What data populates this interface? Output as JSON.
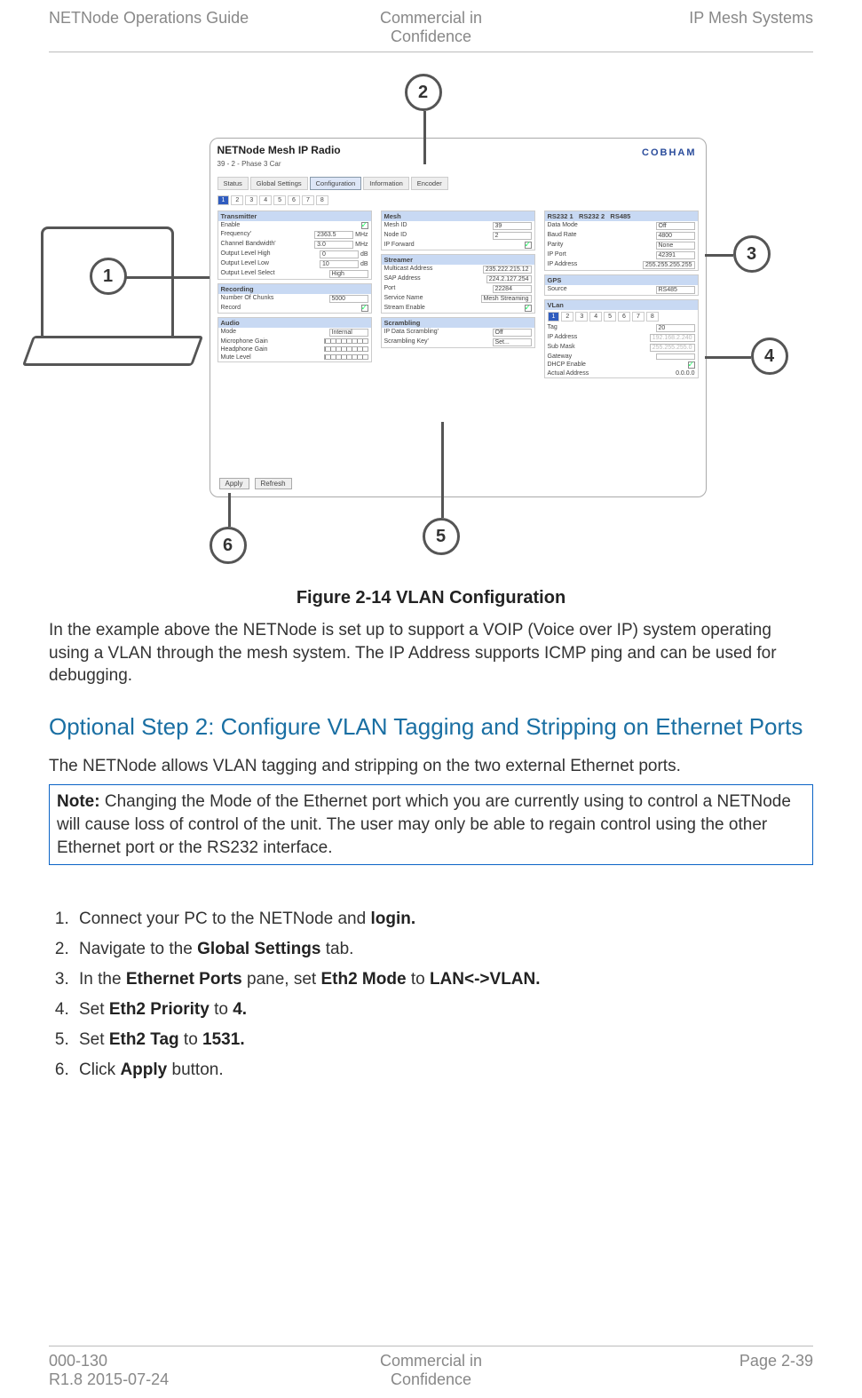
{
  "header": {
    "left": "NETNode Operations Guide",
    "center_l1": "Commercial in",
    "center_l2": "Confidence",
    "right": "IP Mesh Systems"
  },
  "fig": {
    "caption": "Figure 2-14 VLAN Configuration",
    "img": {
      "title": "NETNode Mesh IP Radio",
      "subtitle": "39 - 2 - Phase 3 Car",
      "logo": "COBHAM",
      "maintabs": [
        "Status",
        "Global Settings",
        "Configuration",
        "Information",
        "Encoder"
      ],
      "maintab_active": 2,
      "subtabs": [
        "1",
        "2",
        "3",
        "4",
        "5",
        "6",
        "7",
        "8"
      ],
      "subtab_active": 0,
      "vlan_tabs": [
        "1",
        "2",
        "3",
        "4",
        "5",
        "6",
        "7",
        "8"
      ],
      "vlan_tab_active": 0,
      "btn_apply": "Apply",
      "btn_refresh": "Refresh",
      "groups": {
        "transmitter": {
          "h": "Transmitter",
          "rows": [
            [
              "Enable",
              "chk-on"
            ],
            [
              "Frequency'",
              "2363.5",
              "MHz"
            ],
            [
              "Channel Bandwidth'",
              "3.0",
              "MHz"
            ],
            [
              "Output Level High",
              "0",
              "dB"
            ],
            [
              "Output Level Low",
              "10",
              "dB"
            ],
            [
              "Output Level Select",
              "High"
            ]
          ]
        },
        "recording": {
          "h": "Recording",
          "rows": [
            [
              "Number Of Chunks",
              "5000"
            ],
            [
              "Record",
              "chk-on"
            ]
          ]
        },
        "audio": {
          "h": "Audio",
          "rows": [
            [
              "Mode",
              "Internal"
            ],
            [
              "Microphone Gain",
              "slider"
            ],
            [
              "Headphone Gain",
              "slider"
            ],
            [
              "Mute Level",
              "slider"
            ]
          ]
        },
        "mesh": {
          "h": "Mesh",
          "rows": [
            [
              "Mesh ID",
              "39"
            ],
            [
              "Node ID",
              "2"
            ],
            [
              "IP Forward",
              "chk-on"
            ]
          ]
        },
        "streamer": {
          "h": "Streamer",
          "rows": [
            [
              "Multicast Address",
              "235.222.215.12"
            ],
            [
              "SAP Address",
              "224.2.127.254"
            ],
            [
              "Port",
              "22284"
            ],
            [
              "Service Name",
              "Mesh Streaming"
            ],
            [
              "Stream Enable",
              "chk-on"
            ]
          ]
        },
        "scrambling": {
          "h": "Scrambling",
          "rows": [
            [
              "IP Data Scrambling'",
              "Off"
            ],
            [
              "Scrambling Key'",
              "Set..."
            ]
          ]
        },
        "rs232": {
          "h": "RS232 1",
          "h2": "RS232 2",
          "h3": "RS485",
          "rows": [
            [
              "Data Mode",
              "Off"
            ],
            [
              "Baud Rate",
              "4800"
            ],
            [
              "Parity",
              "None"
            ],
            [
              "IP Port",
              "42391"
            ],
            [
              "IP Address",
              "255.255.255.255"
            ]
          ]
        },
        "gps": {
          "h": "GPS",
          "rows": [
            [
              "Source",
              "RS485"
            ]
          ]
        },
        "vlan": {
          "h": "VLan",
          "rows": [
            [
              "Tag",
              "20"
            ],
            [
              "IP Address",
              "192.168.2.240"
            ],
            [
              "Sub Mask",
              "255.255.255.0"
            ],
            [
              "Gateway",
              ""
            ],
            [
              "DHCP Enable",
              "chk-on"
            ],
            [
              "Actual Address",
              "0.0.0.0"
            ]
          ]
        }
      }
    },
    "callouts": {
      "1": "1",
      "2": "2",
      "3": "3",
      "4": "4",
      "5": "5",
      "6": "6"
    }
  },
  "paras": {
    "after_fig": "In the example above the NETNode is set up to support a VOIP (Voice over IP) system operating using a VLAN through the mesh system. The IP Address supports ICMP ping and can be used for debugging.",
    "step_title": "Optional Step 2: Configure VLAN Tagging and Stripping on Ethernet Ports",
    "step_intro": "The NETNode allows VLAN tagging and stripping on the two external Ethernet ports.",
    "note_label": "Note:",
    "note_text": " Changing the Mode of the Ethernet port which you are currently using to control a NETNode will cause loss of control of the unit. The user may only be able to regain control using the other Ethernet port or the RS232 interface."
  },
  "steps": [
    {
      "pre": "Connect your PC to the NETNode and ",
      "b": "login."
    },
    {
      "pre": "Navigate to the ",
      "b": "Global Settings",
      "post": " tab."
    },
    {
      "pre": "In the ",
      "b": "Ethernet Ports",
      "mid": " pane, set ",
      "b2": "Eth2 Mode",
      "mid2": " to ",
      "b3": "LAN<->VLAN."
    },
    {
      "pre": "Set ",
      "b": "Eth2 Priority",
      "mid": " to ",
      "b2": "4."
    },
    {
      "pre": "Set ",
      "b": "Eth2 Tag",
      "mid": " to ",
      "b2": "1531."
    },
    {
      "pre": "Click ",
      "b": "Apply",
      "post": " button."
    }
  ],
  "footer": {
    "l1": "000-130",
    "l2": "R1.8 2015-07-24",
    "c1": "Commercial in",
    "c2": "Confidence",
    "r": "Page 2-39"
  }
}
